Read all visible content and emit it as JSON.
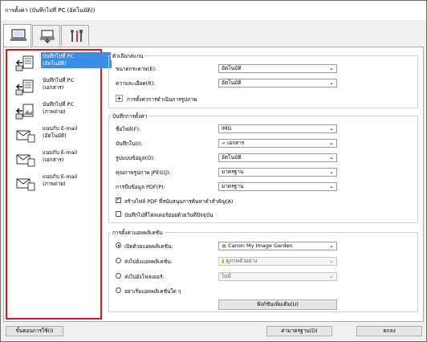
{
  "window": {
    "title": "การตั้งค่า (บันทึกไปที่ PC (อัตโนมัติ))"
  },
  "tabs": [
    {
      "name": "scan-from-computer",
      "icon": "computer-icon"
    },
    {
      "name": "scan-from-panel",
      "icon": "scanner-icon"
    },
    {
      "name": "general-settings",
      "icon": "tools-icon"
    }
  ],
  "sidebar": {
    "items": [
      {
        "label1": "บันทึกไปที่ PC",
        "label2": "(อัตโนมัติ)",
        "selected": true,
        "icon": "save-to-pc-auto-icon"
      },
      {
        "label1": "บันทึกไปที่ PC",
        "label2": "(เอกสาร)",
        "selected": false,
        "icon": "save-to-pc-document-icon"
      },
      {
        "label1": "บันทึกไปที่ PC",
        "label2": "(ภาพถ่าย)",
        "selected": false,
        "icon": "save-to-pc-photo-icon"
      },
      {
        "label1": "แนบกับ E-mail",
        "label2": "(อัตโนมัติ)",
        "selected": false,
        "icon": "email-auto-icon"
      },
      {
        "label1": "แนบกับ E-mail",
        "label2": "(เอกสาร)",
        "selected": false,
        "icon": "email-document-icon"
      },
      {
        "label1": "แนบกับ E-mail",
        "label2": "(ภาพถ่าย)",
        "selected": false,
        "icon": "email-photo-icon"
      }
    ]
  },
  "scan_options": {
    "title": "ตัวเลือกสแกน",
    "paper_size_label": "ขนาดกระดาษ(E):",
    "paper_size_value": "อัตโนมัติ",
    "resolution_label": "ความละเอียด(R):",
    "resolution_value": "อัตโนมัติ",
    "image_processing_label": "การตั้งค่าการดำเนินการรูปภาพ"
  },
  "save_settings": {
    "title": "บันทึกการตั้งค่า",
    "filename_label": "ชื่อไฟล์(F):",
    "filename_value": "IMG",
    "save_in_label": "บันทึกใน(I):",
    "save_in_value": "เอกสาร",
    "data_format_label": "รูปแบบข้อมูล(O):",
    "data_format_value": "อัตโนมัติ",
    "jpeg_quality_label": "คุณภาพรูปภาพ JPEG(J):",
    "jpeg_quality_value": "มาตรฐาน",
    "pdf_compression_label": "การบีบข้อมูล PDF(P):",
    "pdf_compression_value": "มาตรฐาน",
    "keyword_pdf_label": "สร้างไฟล์ PDF ที่สนับสนุนการค้นหาคำสำคัญ(A)",
    "keyword_pdf_checked": true,
    "subfolder_label": "บันทึกไปที่โฟลเดอร์ย่อยด้วยวันที่ปัจจุบัน",
    "subfolder_checked": false
  },
  "app_settings": {
    "title": "การตั้งค่าแอพพลิเคชั่น",
    "open_app_label": "เปิดด้วยแอพพลิเคชั่น:",
    "open_app_value": "Canon My Image Garden",
    "send_app_label": "ส่งไปยังแอพพลิเคชั่น:",
    "send_app_value": "ดูภาพตัวอย่าง",
    "send_folder_label": "ส่งไปยังโฟลเดอร์:",
    "send_folder_value": "ไม่มี",
    "no_app_label": "อย่าเริ่มแอพพลิเคชั่นใด ๆ",
    "selected_option": "open_app",
    "more_functions_button": "ฟังก์ชันเพิ่มเติม(U)"
  },
  "footer": {
    "instructions_button": "ขั้นตอนการใช้(I)",
    "defaults_button": "ค่ามาตรฐาน(D)",
    "ok_button": "ตกลง"
  },
  "colors": {
    "highlight": "#e11111",
    "selected": "#3b8ee6"
  }
}
